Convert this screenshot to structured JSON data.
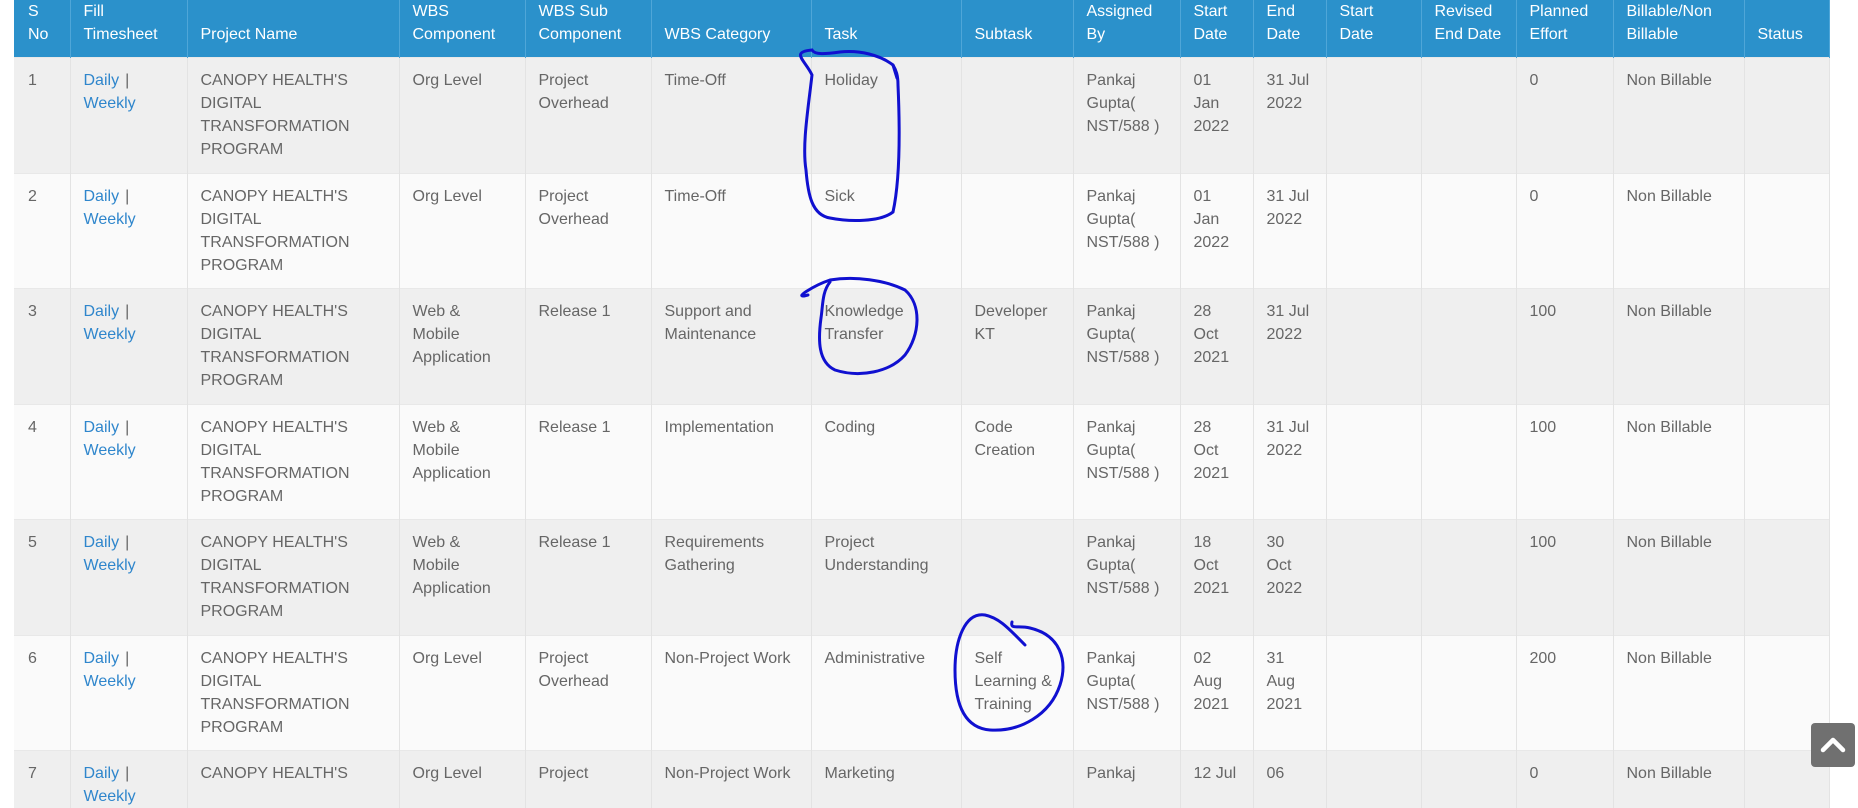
{
  "headers": [
    {
      "key": "sno",
      "label": "S\nNo"
    },
    {
      "key": "fill",
      "label": "Fill\nTimesheet"
    },
    {
      "key": "project",
      "label": "Project Name"
    },
    {
      "key": "wbs_component",
      "label": "WBS\nComponent"
    },
    {
      "key": "wbs_sub",
      "label": "WBS Sub\nComponent"
    },
    {
      "key": "wbs_category",
      "label": "WBS Category"
    },
    {
      "key": "task",
      "label": "Task"
    },
    {
      "key": "subtask",
      "label": "Subtask"
    },
    {
      "key": "assigned_by",
      "label": "Assigned\nBy"
    },
    {
      "key": "start",
      "label": "Start\nDate"
    },
    {
      "key": "end",
      "label": "End\nDate"
    },
    {
      "key": "start2",
      "label": "Start\nDate"
    },
    {
      "key": "revised_end",
      "label": "Revised\nEnd Date"
    },
    {
      "key": "planned",
      "label": "Planned\nEffort"
    },
    {
      "key": "billable",
      "label": "Billable/Non\nBillable"
    },
    {
      "key": "status",
      "label": "Status"
    }
  ],
  "fill_links": {
    "daily": "Daily",
    "separator": "|",
    "weekly": "Weekly"
  },
  "rows": [
    {
      "sno": "1",
      "project": "CANOPY HEALTH'S DIGITAL TRANSFORMATION PROGRAM",
      "wbs_component": "Org Level",
      "wbs_sub": "Project Overhead",
      "wbs_category": "Time-Off",
      "task": "Holiday",
      "subtask": "",
      "assigned_by": "Pankaj Gupta( NST/588 )",
      "start": "01 Jan 2022",
      "end": "31 Jul 2022",
      "start2": "",
      "revised_end": "",
      "planned": "0",
      "billable": "Non Billable",
      "status": ""
    },
    {
      "sno": "2",
      "project": "CANOPY HEALTH'S DIGITAL TRANSFORMATION PROGRAM",
      "wbs_component": "Org Level",
      "wbs_sub": "Project Overhead",
      "wbs_category": "Time-Off",
      "task": "Sick",
      "subtask": "",
      "assigned_by": "Pankaj Gupta( NST/588 )",
      "start": "01 Jan 2022",
      "end": "31 Jul 2022",
      "start2": "",
      "revised_end": "",
      "planned": "0",
      "billable": "Non Billable",
      "status": ""
    },
    {
      "sno": "3",
      "project": "CANOPY HEALTH'S DIGITAL TRANSFORMATION PROGRAM",
      "wbs_component": "Web & Mobile Application",
      "wbs_sub": "Release 1",
      "wbs_category": "Support and Maintenance",
      "task": "Knowledge Transfer",
      "subtask": "Developer KT",
      "assigned_by": "Pankaj Gupta( NST/588 )",
      "start": "28 Oct 2021",
      "end": "31 Jul 2022",
      "start2": "",
      "revised_end": "",
      "planned": "100",
      "billable": "Non Billable",
      "status": ""
    },
    {
      "sno": "4",
      "project": "CANOPY HEALTH'S DIGITAL TRANSFORMATION PROGRAM",
      "wbs_component": "Web & Mobile Application",
      "wbs_sub": "Release 1",
      "wbs_category": "Implementation",
      "task": "Coding",
      "subtask": "Code Creation",
      "assigned_by": "Pankaj Gupta( NST/588 )",
      "start": "28 Oct 2021",
      "end": "31 Jul 2022",
      "start2": "",
      "revised_end": "",
      "planned": "100",
      "billable": "Non Billable",
      "status": ""
    },
    {
      "sno": "5",
      "project": "CANOPY HEALTH'S DIGITAL TRANSFORMATION PROGRAM",
      "wbs_component": "Web & Mobile Application",
      "wbs_sub": "Release 1",
      "wbs_category": "Requirements Gathering",
      "task": "Project Understanding",
      "subtask": "",
      "assigned_by": "Pankaj Gupta( NST/588 )",
      "start": "18 Oct 2021",
      "end": "30 Oct 2022",
      "start2": "",
      "revised_end": "",
      "planned": "100",
      "billable": "Non Billable",
      "status": ""
    },
    {
      "sno": "6",
      "project": "CANOPY HEALTH'S DIGITAL TRANSFORMATION PROGRAM",
      "wbs_component": "Org Level",
      "wbs_sub": "Project Overhead",
      "wbs_category": "Non-Project Work",
      "task": "Administrative",
      "subtask": "Self Learning & Training",
      "assigned_by": "Pankaj Gupta( NST/588 )",
      "start": "02 Aug 2021",
      "end": "31 Aug 2021",
      "start2": "",
      "revised_end": "",
      "planned": "200",
      "billable": "Non Billable",
      "status": ""
    },
    {
      "sno": "7",
      "project": "CANOPY HEALTH'S",
      "wbs_component": "Org Level",
      "wbs_sub": "Project",
      "wbs_category": "Non-Project Work",
      "task": "Marketing",
      "subtask": "",
      "assigned_by": "Pankaj",
      "start": "12 Jul",
      "end": "06",
      "start2": "",
      "revised_end": "",
      "planned": "0",
      "billable": "Non Billable",
      "status": ""
    }
  ],
  "scroll_top_icon": "chevron-up-icon",
  "colors": {
    "header": "#2b91cb",
    "link": "#2f86cc",
    "annotation": "#1010d0",
    "scroll_button": "#707070"
  }
}
